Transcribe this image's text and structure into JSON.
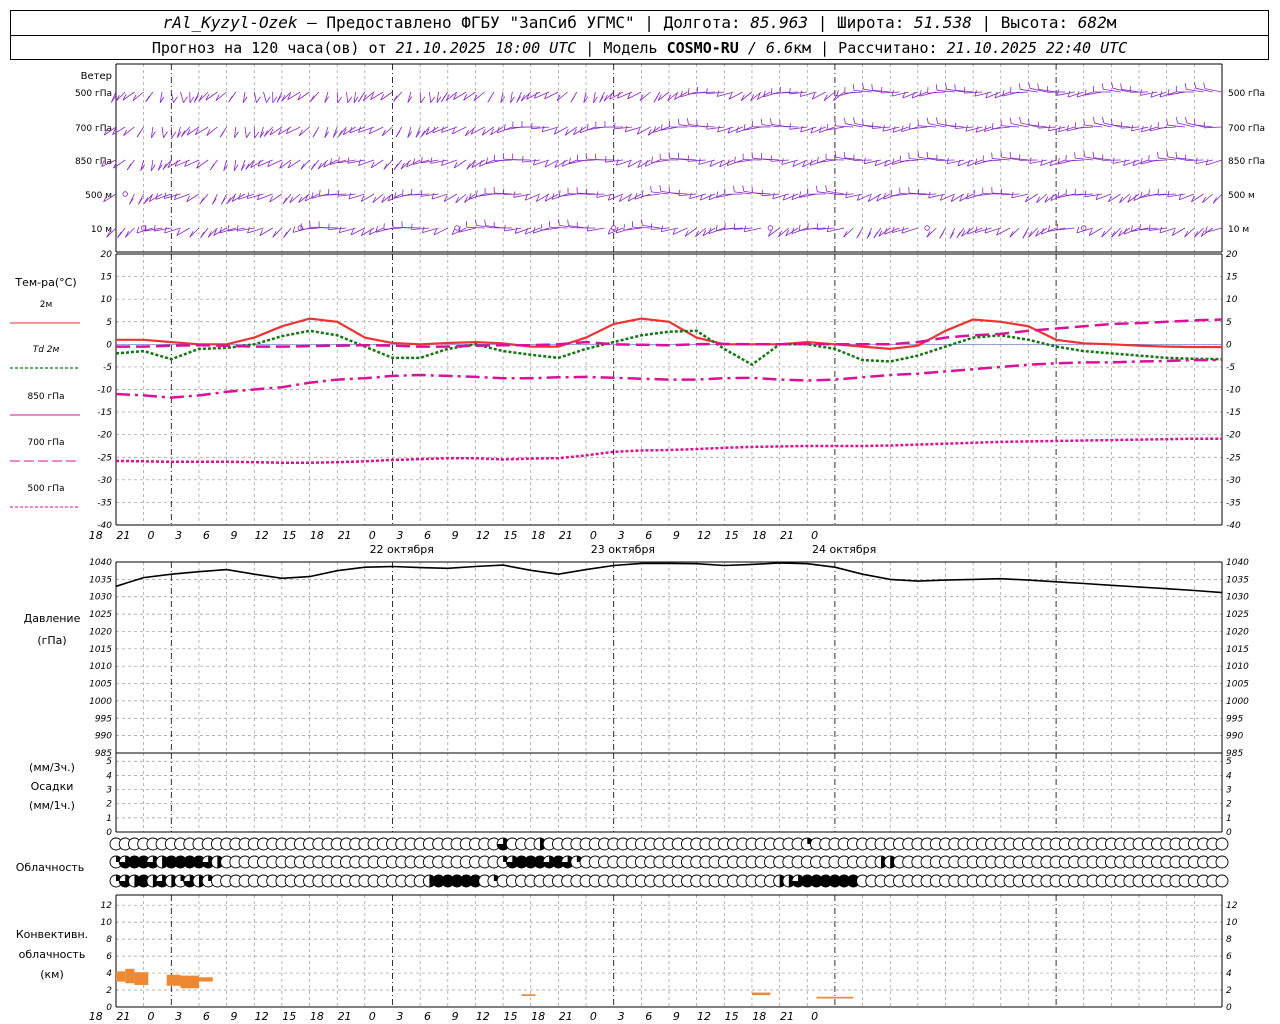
{
  "header": {
    "station": "rAl_Kyzyl-Ozek",
    "provider": " — Предоставлено ФГБУ \"ЗапСиб УГМС\" | Долгота: ",
    "lon": "85.963",
    "lat_label": " | Широта: ",
    "lat": "51.538",
    "alt_label": " | Высота: ",
    "alt": "682",
    "alt_unit": "м",
    "fc_prefix": "Прогноз на 120 часа(ов) от ",
    "fc_time": "21.10.2025 18:00 UTC",
    "model_label": " | Модель ",
    "model": "COSMO-RU",
    "res": " / 6.6",
    "res_unit": "км",
    "calc_label": " | Рассчитано: ",
    "calc_time": "21.10.2025 22:40 UTC"
  },
  "colors": {
    "t2m": "#ee3333",
    "td": "#117711",
    "t850": "#dd1199",
    "t700": "#dd1199",
    "t500": "#dd1199",
    "wind": "#8822cc",
    "pressure": "#000000",
    "conv": "#ee8833",
    "grid": "#999999"
  },
  "wind_panel": {
    "title": "Ветер",
    "levels": [
      "500 гПа",
      "700 гПа",
      "850 гПа",
      "500 м",
      "10 м"
    ]
  },
  "temp_panel": {
    "title": "Тем-ра(°C)",
    "legend": [
      "2м",
      "Td  2м",
      "850 гПа",
      "700 гПа",
      "500 гПа"
    ],
    "yticks": [
      "20",
      "15",
      "10",
      "5",
      "0",
      "-5",
      "-10",
      "-15",
      "-20",
      "-25",
      "-30",
      "-35",
      "-40"
    ]
  },
  "time_axis": {
    "hour_labels": [
      "18",
      "21",
      "0",
      "3",
      "6",
      "9",
      "12",
      "15",
      "18",
      "21",
      "0",
      "3",
      "6",
      "9",
      "12",
      "15",
      "18",
      "21",
      "0",
      "3",
      "6",
      "9",
      "12",
      "15",
      "18",
      "21",
      "0"
    ],
    "dates": [
      "22 октября",
      "23 октября",
      "24 октября"
    ]
  },
  "pressure_panel": {
    "title1": "Давление",
    "title2": "(гПа)",
    "yticks": [
      "1040",
      "1035",
      "1030",
      "1025",
      "1020",
      "1015",
      "1010",
      "1005",
      "1000",
      "995",
      "990",
      "985"
    ]
  },
  "precip_panel": {
    "l1": "(мм/3ч.)",
    "l2": "Осадки",
    "l3": "(мм/1ч.)",
    "yticks": [
      "5",
      "4",
      "3",
      "2",
      "1",
      "0"
    ]
  },
  "cloud_panel": {
    "title": "Облачность"
  },
  "conv_panel": {
    "l1": "Конвективн.",
    "l2": "облачность",
    "l3": "(км)",
    "yticks": [
      "12",
      "10",
      "8",
      "6",
      "4",
      "2",
      "0"
    ]
  },
  "chart_data": [
    {
      "type": "line",
      "title": "Тем-ра(°C)",
      "x": [
        0,
        3,
        6,
        9,
        12,
        15,
        18,
        21,
        24,
        27,
        30,
        33,
        36,
        39,
        42,
        45,
        48,
        51,
        54,
        57,
        60,
        63,
        66,
        69,
        72,
        75,
        78,
        81,
        84,
        87,
        90,
        93,
        96,
        99,
        102,
        105,
        108,
        111,
        114,
        117,
        120
      ],
      "x_labels_note": "hours after 21.10.2025 18:00 UTC",
      "ylim": [
        -40,
        20
      ],
      "series": [
        {
          "name": "2м",
          "values": [
            1,
            1,
            0.5,
            0,
            0,
            1.5,
            4,
            5.7,
            5,
            1.5,
            0.3,
            0,
            0.3,
            0.5,
            0.2,
            -0.5,
            -0.5,
            1.5,
            4.5,
            5.7,
            5,
            1.5,
            0,
            0,
            0,
            0.5,
            0,
            -0.5,
            -1,
            -0.3,
            3,
            5.5,
            5,
            4,
            1,
            0.2,
            0,
            -0.3,
            -0.5,
            -0.6,
            -0.6
          ]
        },
        {
          "name": "Td  2м",
          "values": [
            -2,
            -1.5,
            -3.3,
            -1,
            -0.8,
            0,
            1.8,
            3,
            2,
            -0.5,
            -3,
            -3,
            -1,
            0,
            -1.5,
            -2.3,
            -3,
            -1,
            0.5,
            2,
            2.8,
            3,
            -1,
            -4.5,
            0,
            0,
            -1,
            -3.5,
            -3.8,
            -2.5,
            -0.5,
            1.5,
            2,
            1,
            -0.5,
            -1.5,
            -2,
            -2.5,
            -3,
            -3.2,
            -3.3
          ]
        },
        {
          "name": "850 гПа",
          "values": [
            -11,
            -11.3,
            -11.8,
            -11.3,
            -10.5,
            -10,
            -9.5,
            -8.5,
            -7.8,
            -7.5,
            -7,
            -6.8,
            -7,
            -7.2,
            -7.5,
            -7.5,
            -7.3,
            -7.2,
            -7.4,
            -7.6,
            -7.8,
            -7.8,
            -7.5,
            -7.4,
            -7.8,
            -8,
            -7.8,
            -7.3,
            -6.8,
            -6.5,
            -6,
            -5.5,
            -5,
            -4.5,
            -4.2,
            -4,
            -4,
            -3.8,
            -3.7,
            -3.5,
            -3.5
          ]
        },
        {
          "name": "700 гПа",
          "values": [
            -0.5,
            -0.5,
            -0.3,
            -0.2,
            -0.3,
            -0.5,
            -0.5,
            -0.4,
            -0.3,
            -0.2,
            -0.3,
            -0.5,
            -0.5,
            -0.3,
            -0.2,
            -0.2,
            0,
            0.5,
            0,
            -0.1,
            -0.2,
            0,
            0.1,
            0,
            0,
            0.1,
            0,
            0,
            0,
            0.5,
            1.5,
            2,
            2.3,
            3,
            3.5,
            4,
            4.5,
            4.7,
            5,
            5.3,
            5.5
          ]
        },
        {
          "name": "500 гПа",
          "values": [
            -25.8,
            -25.9,
            -26,
            -26,
            -26,
            -26.1,
            -26.2,
            -26.2,
            -26.1,
            -25.9,
            -25.6,
            -25.4,
            -25.2,
            -25.2,
            -25.5,
            -25.3,
            -25.2,
            -24.6,
            -23.8,
            -23.5,
            -23.4,
            -23.2,
            -22.9,
            -22.7,
            -22.6,
            -22.5,
            -22.5,
            -22.5,
            -22.4,
            -22.2,
            -22,
            -21.8,
            -21.6,
            -21.5,
            -21.4,
            -21.3,
            -21.2,
            -21.1,
            -21,
            -20.9,
            -20.9
          ]
        }
      ]
    },
    {
      "type": "line",
      "title": "Давление (гПа)",
      "ylim": [
        985,
        1040
      ],
      "series": [
        {
          "name": "Давление",
          "values": [
            1033,
            1035.5,
            1036.5,
            1037.2,
            1037.8,
            1036.5,
            1035.3,
            1035.8,
            1037.5,
            1038.5,
            1038.7,
            1038.4,
            1038.2,
            1038.7,
            1039.1,
            1037.6,
            1036.5,
            1037.8,
            1039,
            1039.6,
            1039.6,
            1039.5,
            1039,
            1039.3,
            1039.7,
            1039.5,
            1038.5,
            1036.5,
            1035,
            1034.5,
            1034.8,
            1035,
            1035.2,
            1034.8,
            1034.3,
            1033.8,
            1033.3,
            1032.8,
            1032.3,
            1031.8,
            1031.2
          ]
        }
      ]
    },
    {
      "type": "bar",
      "title": "Осадки",
      "ylim": [
        0,
        5
      ],
      "values": []
    },
    {
      "type": "table",
      "title": "Облачность",
      "note": "three cloud rows (upper, middle, lower), one symbol per hourly step; 0 clear, 1 quarter, 2 half, 3 three-quarter, 4 overcast",
      "rows": [
        [
          0,
          0,
          0,
          0,
          0,
          0,
          0,
          0,
          0,
          0,
          0,
          0,
          0,
          0,
          0,
          0,
          0,
          0,
          0,
          0,
          0,
          0,
          0,
          0,
          0,
          0,
          0,
          0,
          0,
          0,
          0,
          0,
          0,
          0,
          0,
          0,
          0,
          0,
          0,
          0,
          0,
          0,
          0,
          0,
          0,
          0,
          0,
          0,
          0,
          0,
          0,
          0,
          0,
          0,
          0,
          0,
          0,
          0,
          0,
          0,
          0,
          0,
          0,
          0,
          0,
          0,
          0,
          0,
          0,
          0,
          0,
          0,
          0,
          0,
          0,
          0,
          0,
          0,
          0,
          0,
          0,
          0,
          0,
          0,
          0,
          0,
          0,
          0,
          0,
          0,
          0,
          0,
          0,
          0,
          0,
          0,
          0,
          0,
          0,
          0,
          0,
          0,
          0,
          0,
          0,
          0,
          0,
          0,
          0,
          0,
          0,
          0,
          0,
          0,
          0,
          0,
          0,
          0,
          0,
          0,
          0
        ],
        [
          1,
          3,
          4,
          4,
          3,
          2,
          4,
          4,
          4,
          4,
          3,
          2,
          0,
          0,
          0,
          0,
          0,
          0,
          0,
          0,
          0,
          0,
          0,
          0,
          0,
          0,
          0,
          0,
          0,
          0,
          0,
          0,
          0,
          0,
          0,
          0,
          0,
          0,
          0,
          0,
          0,
          0,
          0,
          0,
          0,
          0,
          0,
          0,
          0,
          0,
          0,
          0,
          0,
          0,
          0,
          0,
          0,
          0,
          0,
          0,
          0,
          0,
          0,
          0,
          0,
          0,
          0,
          0,
          0,
          0,
          0,
          0,
          0,
          0,
          0,
          0,
          0,
          0,
          0,
          0,
          0,
          0,
          0,
          0,
          0,
          0,
          0,
          0,
          0,
          0,
          0,
          0,
          0,
          0,
          0,
          0,
          0,
          0,
          0,
          0,
          0,
          0,
          0,
          0,
          0,
          0,
          0,
          0,
          0,
          0,
          0,
          0,
          0,
          0,
          0,
          0,
          0,
          0,
          0,
          0,
          0
        ],
        [
          1,
          3,
          2,
          4,
          2,
          3,
          2,
          1,
          3,
          2,
          1,
          0,
          0,
          0,
          0,
          0,
          0,
          0,
          0,
          0,
          0,
          0,
          0,
          0,
          0,
          0,
          0,
          0,
          0,
          0,
          0,
          0,
          0,
          0,
          0,
          0,
          0,
          0,
          0,
          0,
          0,
          0,
          0,
          0,
          0,
          0,
          0,
          0,
          0,
          0,
          0,
          0,
          0,
          0,
          0,
          0,
          0,
          0,
          0,
          0,
          0,
          0,
          0,
          0,
          0,
          0,
          0,
          0,
          0,
          0,
          0,
          0,
          0,
          0,
          0,
          0,
          0,
          0,
          0,
          0,
          0,
          0,
          0,
          0,
          0,
          0,
          0,
          0,
          0,
          0,
          0,
          0,
          0,
          0,
          0,
          0,
          0,
          0,
          0,
          0,
          0,
          0,
          0,
          0,
          0,
          0,
          0,
          0,
          0,
          0,
          0,
          0,
          0,
          0,
          0,
          0,
          0,
          0,
          0,
          0,
          0
        ]
      ],
      "events": [
        {
          "row": 0,
          "i": 42,
          "v": 3
        },
        {
          "row": 0,
          "i": 46,
          "v": 2
        },
        {
          "row": 0,
          "i": 75,
          "v": 1
        },
        {
          "row": 1,
          "i": 42,
          "v": 1
        },
        {
          "row": 1,
          "i": 43,
          "v": 3
        },
        {
          "row": 1,
          "i": 44,
          "v": 4
        },
        {
          "row": 1,
          "i": 45,
          "v": 4
        },
        {
          "row": 1,
          "i": 46,
          "v": 4
        },
        {
          "row": 1,
          "i": 47,
          "v": 3
        },
        {
          "row": 1,
          "i": 48,
          "v": 4
        },
        {
          "row": 1,
          "i": 49,
          "v": 3
        },
        {
          "row": 1,
          "i": 50,
          "v": 1
        },
        {
          "row": 1,
          "i": 83,
          "v": 2
        },
        {
          "row": 1,
          "i": 84,
          "v": 2
        },
        {
          "row": 2,
          "i": 34,
          "v": 2
        },
        {
          "row": 2,
          "i": 35,
          "v": 4
        },
        {
          "row": 2,
          "i": 36,
          "v": 4
        },
        {
          "row": 2,
          "i": 37,
          "v": 4
        },
        {
          "row": 2,
          "i": 38,
          "v": 4
        },
        {
          "row": 2,
          "i": 39,
          "v": 4
        },
        {
          "row": 2,
          "i": 41,
          "v": 1
        },
        {
          "row": 2,
          "i": 72,
          "v": 2
        },
        {
          "row": 2,
          "i": 73,
          "v": 2
        },
        {
          "row": 2,
          "i": 74,
          "v": 3
        },
        {
          "row": 2,
          "i": 75,
          "v": 4
        },
        {
          "row": 2,
          "i": 76,
          "v": 4
        },
        {
          "row": 2,
          "i": 77,
          "v": 4
        },
        {
          "row": 2,
          "i": 78,
          "v": 4
        },
        {
          "row": 2,
          "i": 79,
          "v": 4
        },
        {
          "row": 2,
          "i": 80,
          "v": 4
        }
      ]
    },
    {
      "type": "bar",
      "title": "Конвективн. облачность (км)",
      "ylim": [
        0,
        13
      ],
      "bars": [
        {
          "x0": 0,
          "x1": 1,
          "lo": 3,
          "hi": 4.2
        },
        {
          "x0": 1,
          "x1": 2,
          "lo": 2.8,
          "hi": 4.5
        },
        {
          "x0": 2,
          "x1": 3.5,
          "lo": 2.6,
          "hi": 4.1
        },
        {
          "x0": 5.5,
          "x1": 7,
          "lo": 2.5,
          "hi": 3.8
        },
        {
          "x0": 7,
          "x1": 9,
          "lo": 2.2,
          "hi": 3.7
        },
        {
          "x0": 9,
          "x1": 10.5,
          "lo": 3,
          "hi": 3.5
        },
        {
          "x0": 44,
          "x1": 45.5,
          "lo": 1.3,
          "hi": 1.5
        },
        {
          "x0": 69,
          "x1": 71,
          "lo": 1.4,
          "hi": 1.7
        },
        {
          "x0": 76,
          "x1": 80,
          "lo": 1,
          "hi": 1.2
        }
      ]
    }
  ]
}
